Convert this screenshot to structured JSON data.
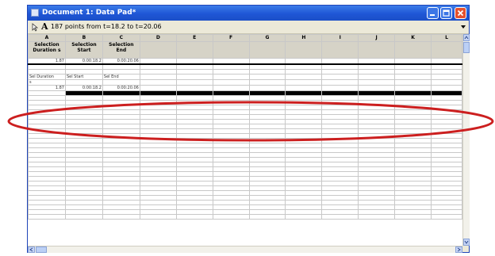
{
  "window": {
    "title": "Document 1: Data Pad*"
  },
  "toolbar": {
    "info": "187 points from t=18.2 to t=20.06",
    "font_glyph": "A"
  },
  "grid": {
    "col_letters": [
      "A",
      "B",
      "C",
      "D",
      "E",
      "F",
      "G",
      "H",
      "I",
      "J",
      "K",
      "L"
    ],
    "col_names": [
      "Selection Duration s",
      "Selection Start",
      "Selection End",
      "",
      "",
      "",
      "",
      "",
      "",
      "",
      "",
      ""
    ],
    "row1": [
      "1.87",
      "0:00:18.2",
      "0:00:20.06"
    ],
    "row3": [
      "Sel Duration",
      "Sel Start",
      "Sel End"
    ],
    "row4": [
      "s",
      "",
      ""
    ],
    "row5": [
      "1.87",
      "0:00:18.2",
      "0:00:20.06"
    ]
  },
  "annotation": {
    "ellipse_color": "#cc1f1f"
  },
  "colors": {
    "titlebar": "#1f56d6",
    "close_button": "#e5512e"
  }
}
